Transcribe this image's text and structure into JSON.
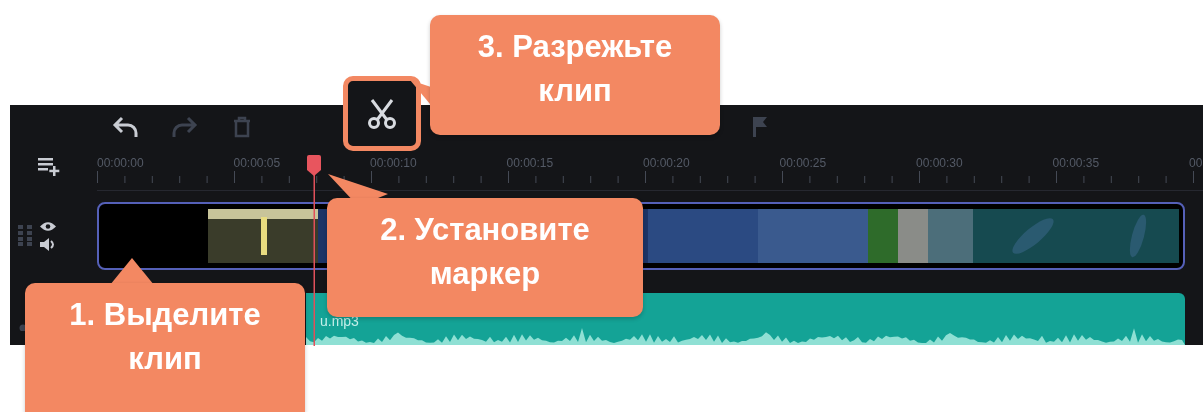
{
  "toolbar": [
    {
      "kind": "undo",
      "disabled": false
    },
    {
      "kind": "redo",
      "disabled": true
    },
    {
      "kind": "delete",
      "disabled": true
    },
    {
      "kind": "cut",
      "highlighted": true
    },
    {
      "kind": "marker",
      "disabled": true
    }
  ],
  "ruler": {
    "labels": [
      "00:00:00",
      "00:00:05",
      "00:00:10",
      "00:00:15",
      "00:00:20",
      "00:00:25",
      "00:00:30",
      "00:00:35",
      "00"
    ]
  },
  "video_track": {
    "clip": {
      "selected": true,
      "kind": "picture"
    }
  },
  "audio_track": {
    "clip": {
      "name": "u.mp3"
    }
  },
  "callouts": [
    {
      "lines": [
        "1. Выделите",
        "клип"
      ]
    },
    {
      "lines": [
        "2. Установите",
        "маркер"
      ]
    },
    {
      "lines": [
        "3. Разрежьте",
        "клип"
      ]
    }
  ]
}
